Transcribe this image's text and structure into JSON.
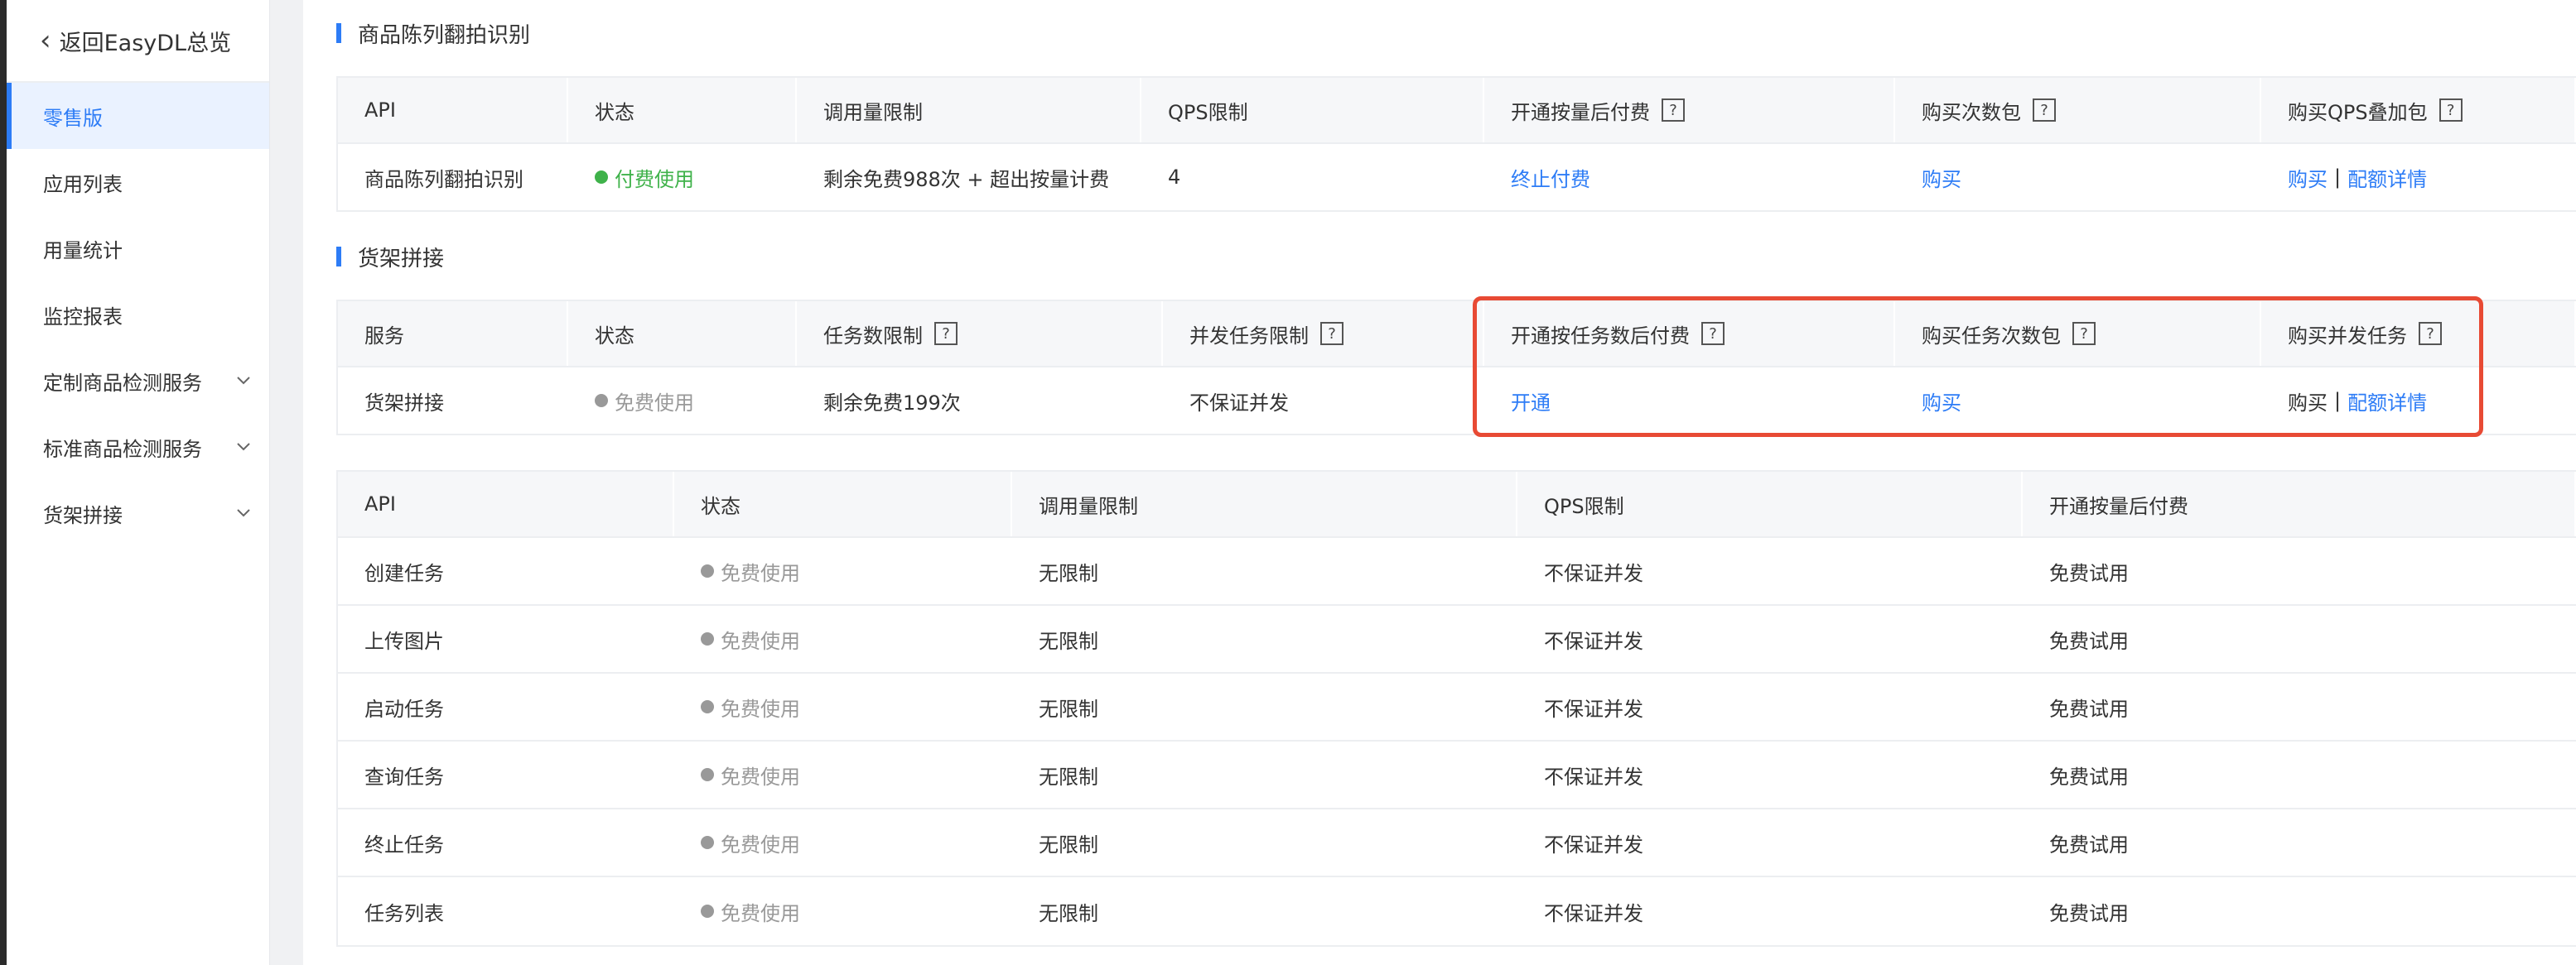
{
  "sidebar": {
    "back_label": "返回EasyDL总览",
    "items": [
      {
        "label": "零售版",
        "active": true,
        "expandable": false
      },
      {
        "label": "应用列表",
        "active": false,
        "expandable": false
      },
      {
        "label": "用量统计",
        "active": false,
        "expandable": false
      },
      {
        "label": "监控报表",
        "active": false,
        "expandable": false
      },
      {
        "label": "定制商品检测服务",
        "active": false,
        "expandable": true
      },
      {
        "label": "标准商品检测服务",
        "active": false,
        "expandable": true
      },
      {
        "label": "货架拼接",
        "active": false,
        "expandable": true
      }
    ]
  },
  "section1": {
    "title": "商品陈列翻拍识别",
    "headers": [
      "API",
      "状态",
      "调用量限制",
      "QPS限制",
      "开通按量后付费",
      "购买次数包",
      "购买QPS叠加包"
    ],
    "row": {
      "api": "商品陈列翻拍识别",
      "status": "付费使用",
      "limit": "剩余免费988次 + 超出按量计费",
      "qps": "4",
      "postpay": "终止付费",
      "buy_pack": "购买",
      "buy_qps": "购买",
      "separator": "|",
      "quota_detail": "配额详情"
    }
  },
  "section2": {
    "title": "货架拼接",
    "headers": [
      "服务",
      "状态",
      "任务数限制",
      "并发任务限制",
      "开通按任务数后付费",
      "购买任务次数包",
      "购买并发任务"
    ],
    "row": {
      "service": "货架拼接",
      "status": "免费使用",
      "task_limit": "剩余免费199次",
      "concurrency": "不保证并发",
      "postpay": "开通",
      "buy_pack": "购买",
      "buy_concurrency": "购买",
      "separator": "|",
      "quota_detail": "配额详情"
    }
  },
  "section3": {
    "headers": [
      "API",
      "状态",
      "调用量限制",
      "QPS限制",
      "开通按量后付费"
    ],
    "rows": [
      {
        "api": "创建任务",
        "status": "免费使用",
        "limit": "无限制",
        "qps": "不保证并发",
        "postpay": "免费试用"
      },
      {
        "api": "上传图片",
        "status": "免费使用",
        "limit": "无限制",
        "qps": "不保证并发",
        "postpay": "免费试用"
      },
      {
        "api": "启动任务",
        "status": "免费使用",
        "limit": "无限制",
        "qps": "不保证并发",
        "postpay": "免费试用"
      },
      {
        "api": "查询任务",
        "status": "免费使用",
        "limit": "无限制",
        "qps": "不保证并发",
        "postpay": "免费试用"
      },
      {
        "api": "终止任务",
        "status": "免费使用",
        "limit": "无限制",
        "qps": "不保证并发",
        "postpay": "免费试用"
      },
      {
        "api": "任务列表",
        "status": "免费使用",
        "limit": "无限制",
        "qps": "不保证并发",
        "postpay": "免费试用"
      }
    ]
  },
  "help_glyph": "?",
  "colors": {
    "accent": "#2d7cf6",
    "paid": "#3fb24a",
    "free": "#999999",
    "highlight": "#e84a34"
  }
}
